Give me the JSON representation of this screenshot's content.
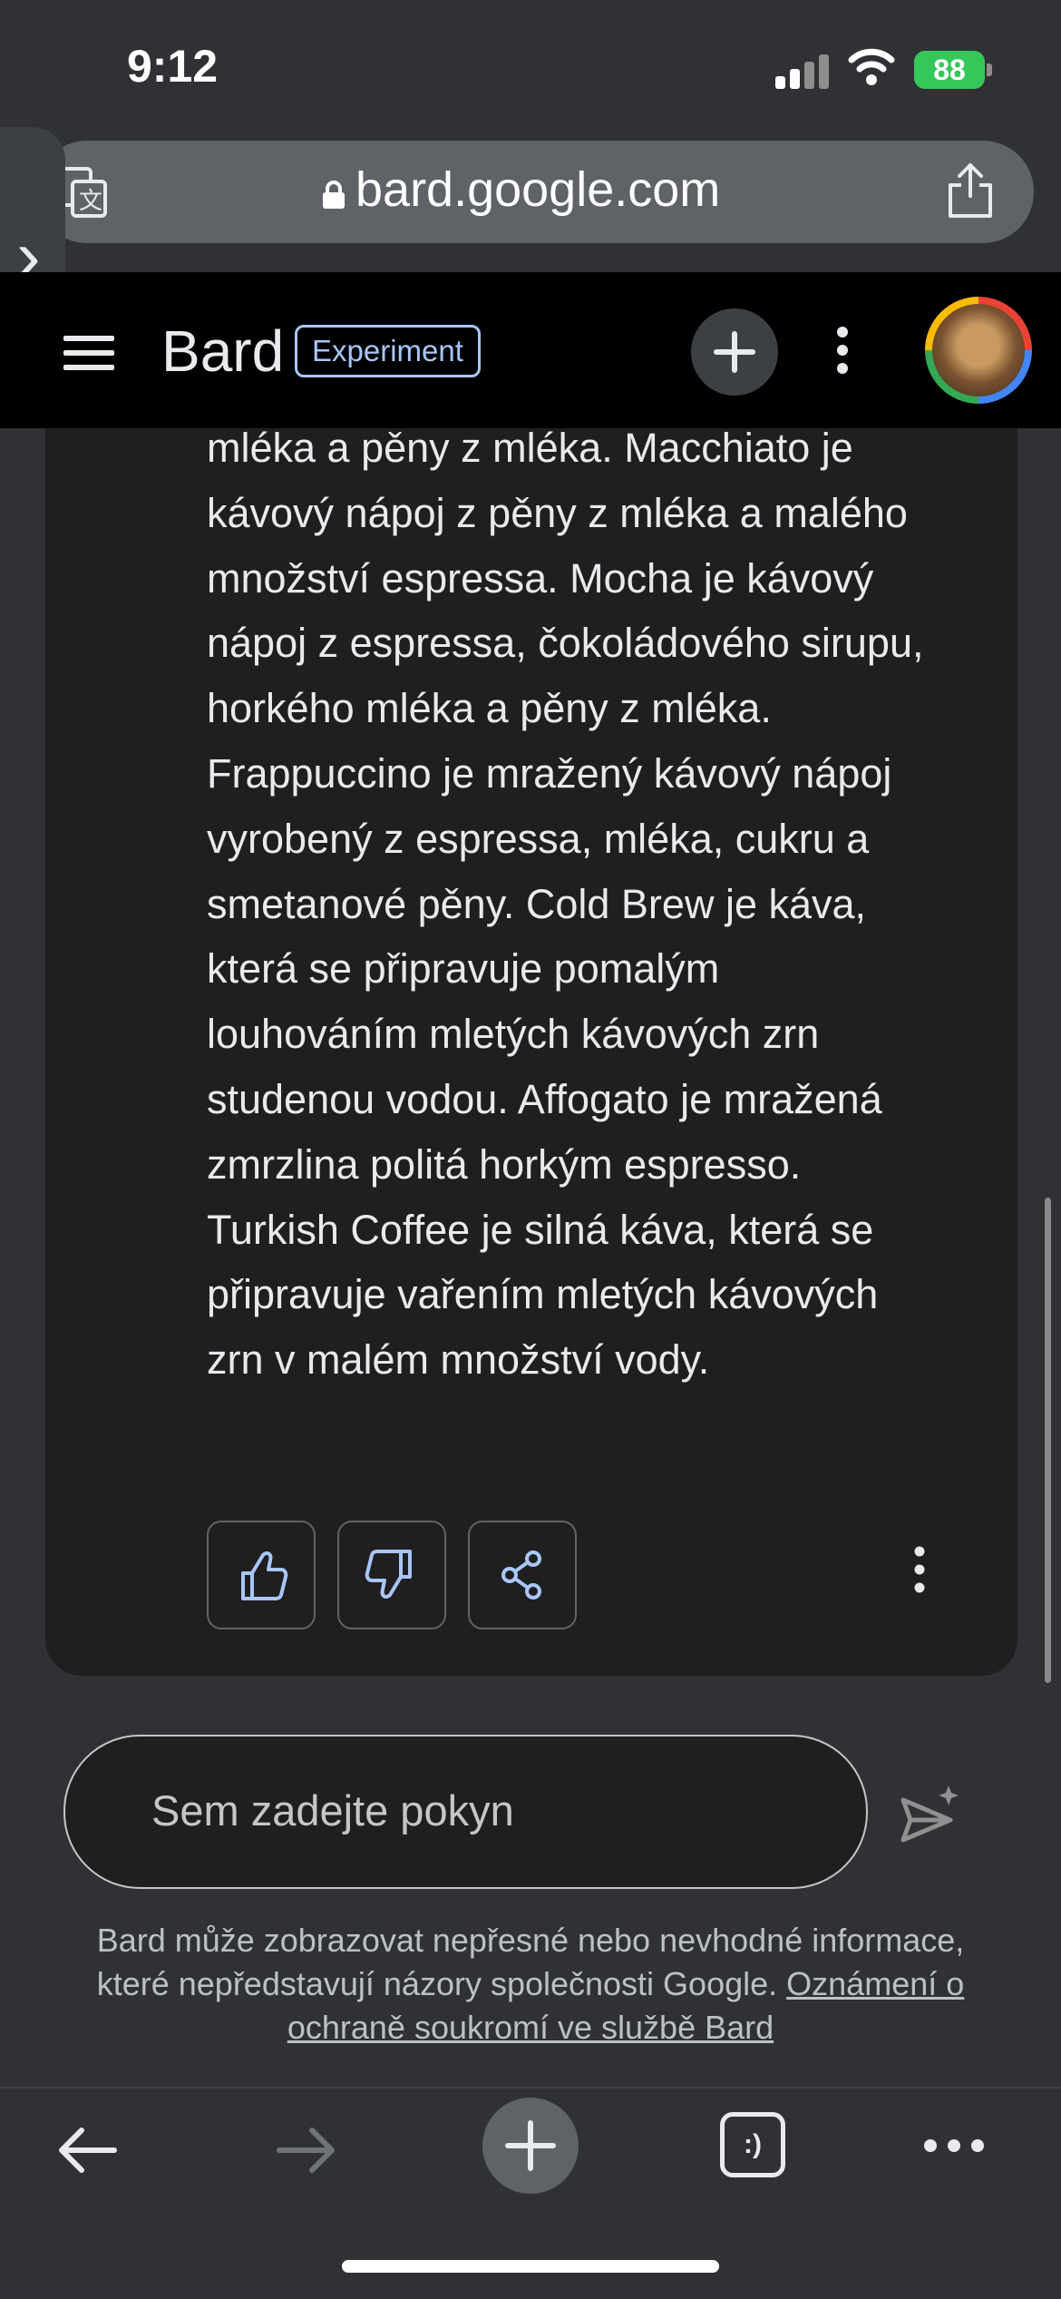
{
  "status_bar": {
    "time": "9:12",
    "battery": "88"
  },
  "browser": {
    "url": "bard.google.com"
  },
  "header": {
    "brand": "Bard",
    "badge": "Experiment"
  },
  "response": {
    "text": "mléka a pěny z mléka. Macchiato je\nkávový nápoj z pěny z mléka a malého\nmnožství espressa. Mocha je kávový\nnápoj z espressa, čokoládového sirupu,\nhorkého mléka a pěny z mléka.\nFrappuccino je mražený kávový nápoj\nvyrobený z espressa, mléka, cukru a\nsmetanové pěny. Cold Brew je káva,\nkterá se připravuje pomalým\nlouhováním mletých kávových zrn\nstudenou vodou. Affogato je mražená\nzmrzlina politá horkým espresso.\nTurkish Coffee je silná káva, která se\npřipravuje vařením mletých kávových\nzrn v malém množství vody."
  },
  "prompt": {
    "placeholder": "Sem zadejte pokyn"
  },
  "disclaimer": {
    "text": "Bard může zobrazovat nepřesné nebo nevhodné informace, které nepředstavují názory společnosti Google. ",
    "link": "Oznámení o ochraně soukromí ve službě Bard"
  },
  "bottom_nav": {
    "tabs_label": ":)"
  },
  "icons": [
    "translate-icon",
    "lock-icon",
    "share-icon",
    "menu-icon",
    "plus-icon",
    "more-vert-icon",
    "avatar",
    "thumbs-up-icon",
    "thumbs-down-icon",
    "share-nodes-icon",
    "send-icon",
    "back-arrow-icon",
    "forward-arrow-icon",
    "new-tab-icon",
    "tabs-icon",
    "more-horiz-icon"
  ],
  "colors": {
    "accent": "#a8c7fa",
    "battery": "#34c759"
  }
}
